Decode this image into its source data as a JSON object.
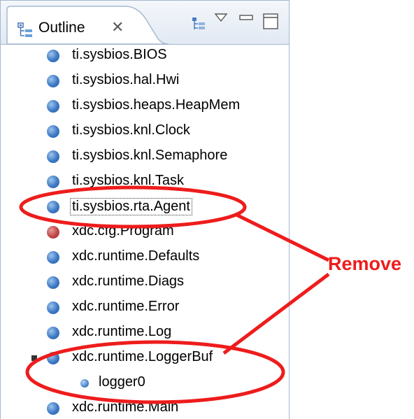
{
  "view": {
    "title": "Outline",
    "close_glyph": "✕",
    "icons": {
      "tab_icon": "outline-icon",
      "toolbar": [
        "hierarchy-icon",
        "view-menu-icon",
        "minimize-icon",
        "maximize-icon"
      ]
    }
  },
  "tree": {
    "items": [
      {
        "label": "ti.sysbios.BIOS",
        "icon": "blue"
      },
      {
        "label": "ti.sysbios.hal.Hwi",
        "icon": "blue"
      },
      {
        "label": "ti.sysbios.heaps.HeapMem",
        "icon": "blue"
      },
      {
        "label": "ti.sysbios.knl.Clock",
        "icon": "blue"
      },
      {
        "label": "ti.sysbios.knl.Semaphore",
        "icon": "blue"
      },
      {
        "label": "ti.sysbios.knl.Task",
        "icon": "blue"
      },
      {
        "label": "ti.sysbios.rta.Agent",
        "icon": "blue",
        "selected": true
      },
      {
        "label": "xdc.cfg.Program",
        "icon": "red"
      },
      {
        "label": "xdc.runtime.Defaults",
        "icon": "blue"
      },
      {
        "label": "xdc.runtime.Diags",
        "icon": "blue"
      },
      {
        "label": "xdc.runtime.Error",
        "icon": "blue"
      },
      {
        "label": "xdc.runtime.Log",
        "icon": "blue"
      },
      {
        "label": "xdc.runtime.LoggerBuf",
        "icon": "blue",
        "expanded": true
      },
      {
        "label": "logger0",
        "icon": "small-blue",
        "child": true
      },
      {
        "label": "xdc.runtime.Main",
        "icon": "blue"
      }
    ]
  },
  "annotation": {
    "text": "Remove",
    "color": "#ee1c1c"
  },
  "colors": {
    "module_icon": "#3c78c4",
    "program_icon": "#c04646",
    "panel_border": "#a6b8d0"
  }
}
